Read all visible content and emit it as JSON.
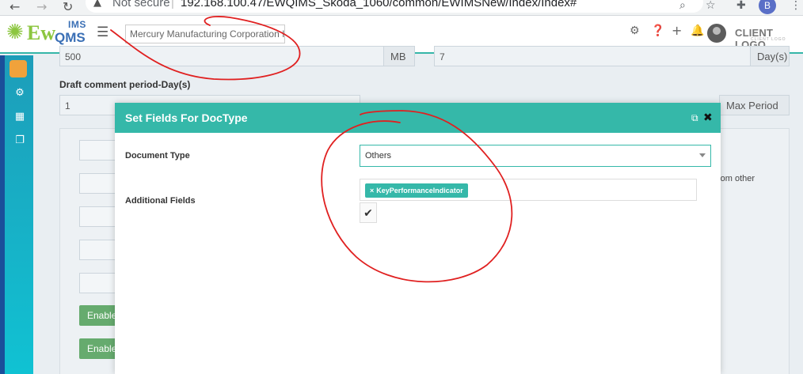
{
  "browser": {
    "back": "←",
    "forward": "→",
    "reload": "↻",
    "security_label": "Not secure",
    "separator": "|",
    "url": "192.168.100.47/EWQIMS_Skoda_1060/common/EWIMSNew/Index/Index#",
    "profile_initial": "B"
  },
  "header": {
    "logo_ew": "Ew",
    "logo_ims": "IMS",
    "logo_qms": "QMS",
    "company": "Mercury Manufacturing Corporation I",
    "client_logo": "CLIENT LOGO",
    "client_logo_sub": "CLIENT LOGO"
  },
  "background": {
    "size_value": "500",
    "size_unit": "MB",
    "days_value": "7",
    "days_unit": "Day(s)",
    "draft_label": "Draft comment period-Day(s)",
    "draft_value": "1",
    "max_period": "Max Period",
    "from_other": "rom other",
    "enable_1": "Enable",
    "enable_2": "Enable"
  },
  "modal": {
    "title": "Set Fields For DocType",
    "document_type_label": "Document Type",
    "document_type_value": "Others",
    "additional_fields_label": "Additional Fields",
    "tags": [
      "KeyPerformanceIndicator"
    ],
    "tag_remove": "×"
  },
  "colors": {
    "accent": "#35b8a9",
    "sidebar_top": "#1d9db9",
    "annotation": "#e02020"
  }
}
